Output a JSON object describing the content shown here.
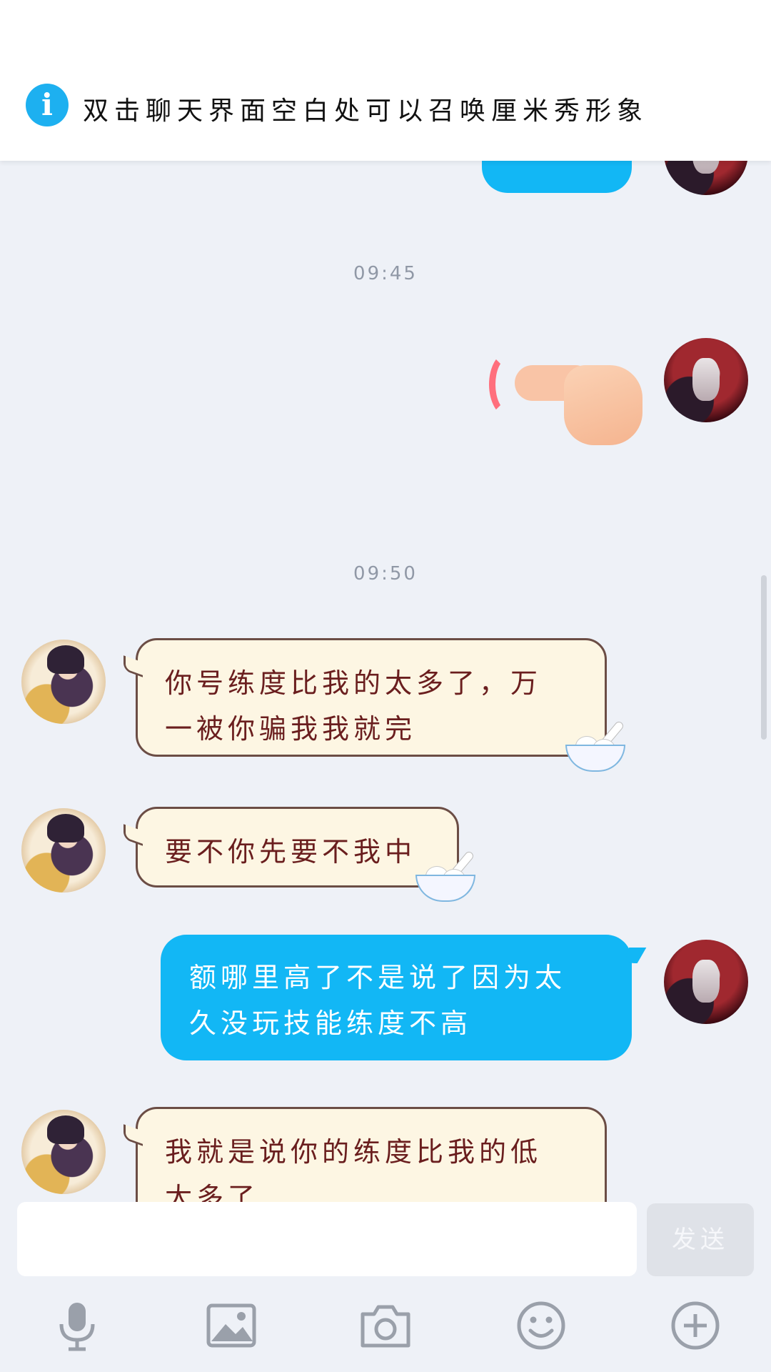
{
  "tip": {
    "icon": "info-icon",
    "icon_glyph": "i",
    "text": "双击聊天界面空白处可以召唤厘米秀形象"
  },
  "timestamps": [
    "09:45",
    "09:50"
  ],
  "messages": [
    {
      "from": "other",
      "text_line1": "你号练度比我的太多了，万",
      "text_line2": "一被你骗我我就完"
    },
    {
      "from": "other",
      "text_line1": "要不你先要不我中"
    },
    {
      "from": "me",
      "text_line1": "额哪里高了不是说了因为太",
      "text_line2": "久没玩技能练度不高"
    },
    {
      "from": "other",
      "text_line1": "我就是说你的练度比我的低",
      "text_line2": "太多了"
    }
  ],
  "poke": {
    "icon": "poke-hand-icon"
  },
  "composer": {
    "input_value": "",
    "send_label": "发送"
  },
  "toolbar": {
    "icons": [
      "microphone-icon",
      "image-icon",
      "camera-icon",
      "emoji-icon",
      "plus-icon"
    ]
  },
  "colors": {
    "accent": "#12b7f5",
    "background": "#eef1f7",
    "bubble_in": "#fdf6e3",
    "bubble_in_text": "#6a1e1e"
  }
}
